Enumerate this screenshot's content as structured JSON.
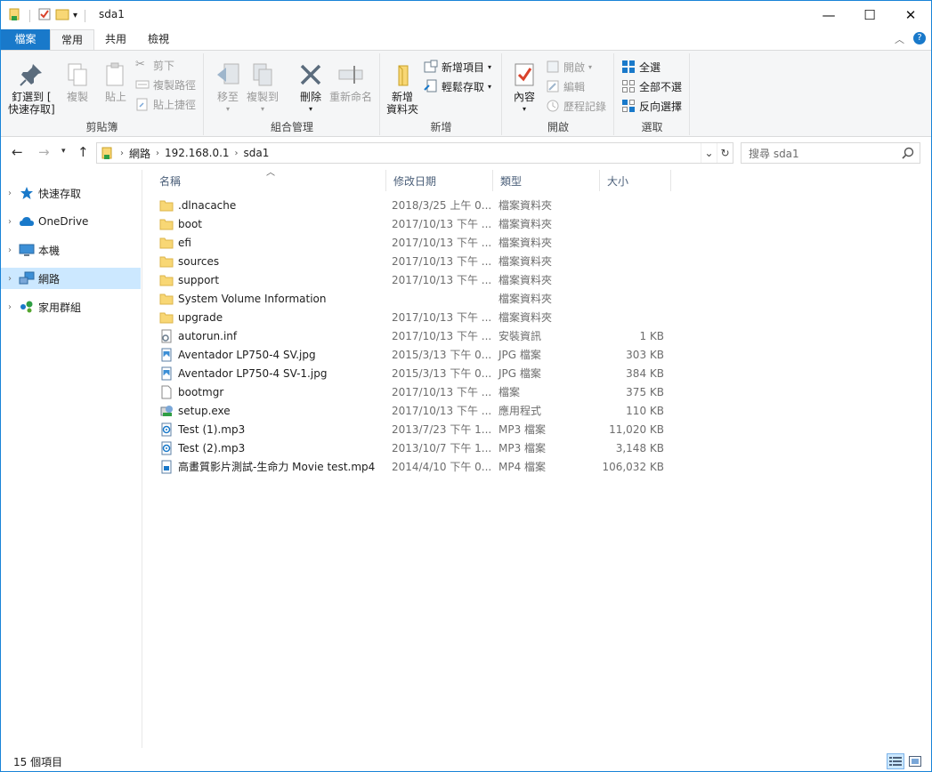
{
  "window": {
    "title": "sda1",
    "minimize": "—",
    "maximize": "☐",
    "close": "✕"
  },
  "ribbon_tabs": {
    "file": "檔案",
    "home": "常用",
    "share": "共用",
    "view": "檢視"
  },
  "ribbon": {
    "clipboard": {
      "label": "剪貼簿",
      "pin_line1": "釘選到 [",
      "pin_line2": "快速存取]",
      "copy": "複製",
      "paste": "貼上",
      "cut": "剪下",
      "copy_path": "複製路徑",
      "paste_shortcut": "貼上捷徑"
    },
    "organize": {
      "label": "組合管理",
      "move_to": "移至",
      "copy_to": "複製到",
      "delete": "刪除",
      "rename": "重新命名"
    },
    "new": {
      "label": "新增",
      "new_folder_line1": "新增",
      "new_folder_line2": "資料夾",
      "new_item": "新增項目",
      "easy_access": "輕鬆存取"
    },
    "open": {
      "label": "開啟",
      "properties": "內容",
      "open": "開啟",
      "edit": "編輯",
      "history": "歷程記錄"
    },
    "select": {
      "label": "選取",
      "select_all": "全選",
      "select_none": "全部不選",
      "invert": "反向選擇"
    }
  },
  "address": {
    "crumbs": [
      "網路",
      "192.168.0.1",
      "sda1"
    ],
    "search_placeholder": "搜尋 sda1"
  },
  "navpane": {
    "items": [
      {
        "label": "快速存取",
        "icon": "star-icon",
        "selected": false
      },
      {
        "label": "OneDrive",
        "icon": "cloud-icon",
        "selected": false
      },
      {
        "label": "本機",
        "icon": "computer-icon",
        "selected": false
      },
      {
        "label": "網路",
        "icon": "network-icon",
        "selected": true
      },
      {
        "label": "家用群組",
        "icon": "homegroup-icon",
        "selected": false
      }
    ]
  },
  "columns": {
    "name": "名稱",
    "date": "修改日期",
    "type": "類型",
    "size": "大小"
  },
  "files": [
    {
      "name": ".dlnacache",
      "date": "2018/3/25 上午 0...",
      "type": "檔案資料夾",
      "size": "",
      "icon": "folder-icon"
    },
    {
      "name": "boot",
      "date": "2017/10/13 下午 ...",
      "type": "檔案資料夾",
      "size": "",
      "icon": "folder-icon"
    },
    {
      "name": "efi",
      "date": "2017/10/13 下午 ...",
      "type": "檔案資料夾",
      "size": "",
      "icon": "folder-icon"
    },
    {
      "name": "sources",
      "date": "2017/10/13 下午 ...",
      "type": "檔案資料夾",
      "size": "",
      "icon": "folder-icon"
    },
    {
      "name": "support",
      "date": "2017/10/13 下午 ...",
      "type": "檔案資料夾",
      "size": "",
      "icon": "folder-icon"
    },
    {
      "name": "System Volume Information",
      "date": "",
      "type": "檔案資料夾",
      "size": "",
      "icon": "folder-icon"
    },
    {
      "name": "upgrade",
      "date": "2017/10/13 下午 ...",
      "type": "檔案資料夾",
      "size": "",
      "icon": "folder-icon"
    },
    {
      "name": "autorun.inf",
      "date": "2017/10/13 下午 ...",
      "type": "安裝資訊",
      "size": "1 KB",
      "icon": "settings-file-icon"
    },
    {
      "name": "Aventador LP750-4 SV.jpg",
      "date": "2015/3/13 下午 0...",
      "type": "JPG 檔案",
      "size": "303 KB",
      "icon": "image-file-icon"
    },
    {
      "name": "Aventador LP750-4 SV-1.jpg",
      "date": "2015/3/13 下午 0...",
      "type": "JPG 檔案",
      "size": "384 KB",
      "icon": "image-file-icon"
    },
    {
      "name": "bootmgr",
      "date": "2017/10/13 下午 ...",
      "type": "檔案",
      "size": "375 KB",
      "icon": "file-icon"
    },
    {
      "name": "setup.exe",
      "date": "2017/10/13 下午 ...",
      "type": "應用程式",
      "size": "110 KB",
      "icon": "setup-exe-icon"
    },
    {
      "name": "Test (1).mp3",
      "date": "2013/7/23 下午 1...",
      "type": "MP3 檔案",
      "size": "11,020 KB",
      "icon": "audio-file-icon"
    },
    {
      "name": "Test (2).mp3",
      "date": "2013/10/7 下午 1...",
      "type": "MP3 檔案",
      "size": "3,148 KB",
      "icon": "audio-file-icon"
    },
    {
      "name": "高畫質影片測試-生命力 Movie test.mp4",
      "date": "2014/4/10 下午 0...",
      "type": "MP4 檔案",
      "size": "106,032 KB",
      "icon": "video-file-icon"
    }
  ],
  "status": {
    "item_count": "15 個項目"
  },
  "colors": {
    "accent": "#1979ca",
    "selection": "#cce8ff",
    "folder": "#f8d775"
  }
}
